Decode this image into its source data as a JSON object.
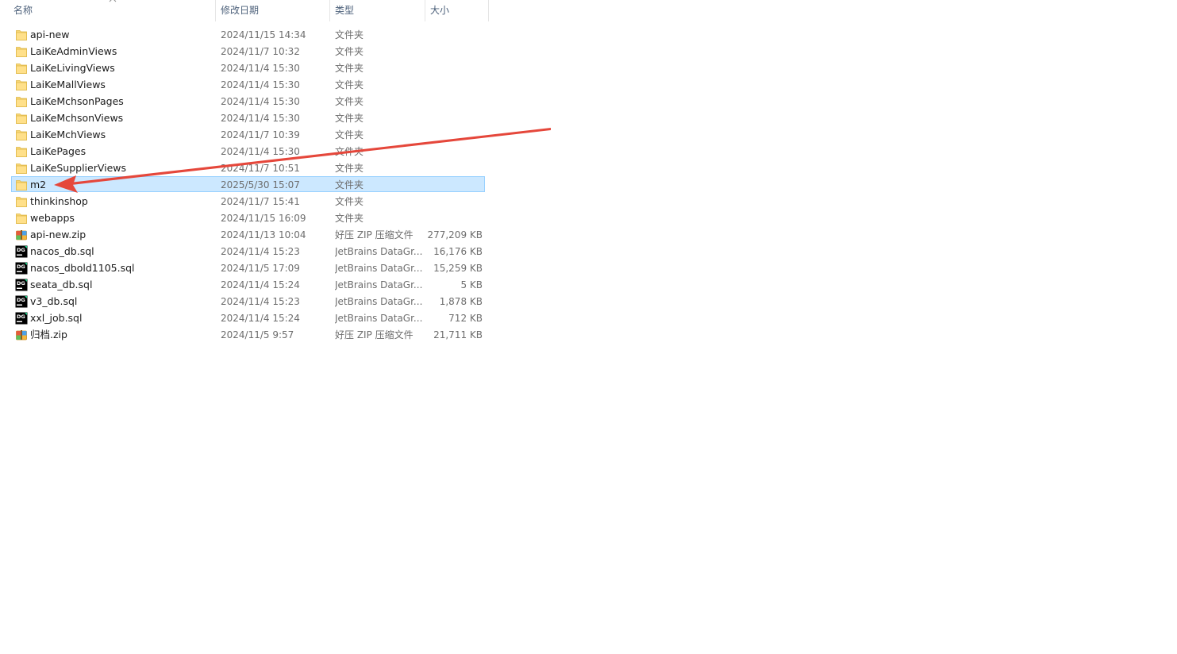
{
  "columns": {
    "name": "名称",
    "date": "修改日期",
    "type": "类型",
    "size": "大小"
  },
  "files": [
    {
      "name": "api-new",
      "date": "2024/11/15 14:34",
      "type": "文件夹",
      "size": "",
      "icon": "folder-icon"
    },
    {
      "name": "LaiKeAdminViews",
      "date": "2024/11/7 10:32",
      "type": "文件夹",
      "size": "",
      "icon": "folder-icon"
    },
    {
      "name": "LaiKeLivingViews",
      "date": "2024/11/4 15:30",
      "type": "文件夹",
      "size": "",
      "icon": "folder-icon"
    },
    {
      "name": "LaiKeMallViews",
      "date": "2024/11/4 15:30",
      "type": "文件夹",
      "size": "",
      "icon": "folder-icon"
    },
    {
      "name": "LaiKeMchsonPages",
      "date": "2024/11/4 15:30",
      "type": "文件夹",
      "size": "",
      "icon": "folder-icon"
    },
    {
      "name": "LaiKeMchsonViews",
      "date": "2024/11/4 15:30",
      "type": "文件夹",
      "size": "",
      "icon": "folder-icon"
    },
    {
      "name": "LaiKeMchViews",
      "date": "2024/11/7 10:39",
      "type": "文件夹",
      "size": "",
      "icon": "folder-icon"
    },
    {
      "name": "LaiKePages",
      "date": "2024/11/4 15:30",
      "type": "文件夹",
      "size": "",
      "icon": "folder-icon"
    },
    {
      "name": "LaiKeSupplierViews",
      "date": "2024/11/7 10:51",
      "type": "文件夹",
      "size": "",
      "icon": "folder-icon"
    },
    {
      "name": "m2",
      "date": "2025/5/30 15:07",
      "type": "文件夹",
      "size": "",
      "icon": "folder-icon",
      "selected": true
    },
    {
      "name": "thinkinshop",
      "date": "2024/11/7 15:41",
      "type": "文件夹",
      "size": "",
      "icon": "folder-icon"
    },
    {
      "name": "webapps",
      "date": "2024/11/15 16:09",
      "type": "文件夹",
      "size": "",
      "icon": "folder-icon"
    },
    {
      "name": "api-new.zip",
      "date": "2024/11/13 10:04",
      "type": "好压 ZIP 压缩文件",
      "size": "277,209 KB",
      "icon": "zip-archive-icon"
    },
    {
      "name": "nacos_db.sql",
      "date": "2024/11/4 15:23",
      "type": "JetBrains DataGr...",
      "size": "16,176 KB",
      "icon": "datagrip-icon"
    },
    {
      "name": "nacos_dbold1105.sql",
      "date": "2024/11/5 17:09",
      "type": "JetBrains DataGr...",
      "size": "15,259 KB",
      "icon": "datagrip-icon"
    },
    {
      "name": "seata_db.sql",
      "date": "2024/11/4 15:24",
      "type": "JetBrains DataGr...",
      "size": "5 KB",
      "icon": "datagrip-icon"
    },
    {
      "name": "v3_db.sql",
      "date": "2024/11/4 15:23",
      "type": "JetBrains DataGr...",
      "size": "1,878 KB",
      "icon": "datagrip-icon"
    },
    {
      "name": "xxl_job.sql",
      "date": "2024/11/4 15:24",
      "type": "JetBrains DataGr...",
      "size": "712 KB",
      "icon": "datagrip-icon"
    },
    {
      "name": "归档.zip",
      "date": "2024/11/5 9:57",
      "type": "好压 ZIP 压缩文件",
      "size": "21,711 KB",
      "icon": "zip-archive-icon"
    }
  ],
  "colors": {
    "selection_bg": "#cce8ff",
    "selection_border": "#99d1ff",
    "annotation_arrow": "#e5473b",
    "folder": "#ffd868"
  }
}
